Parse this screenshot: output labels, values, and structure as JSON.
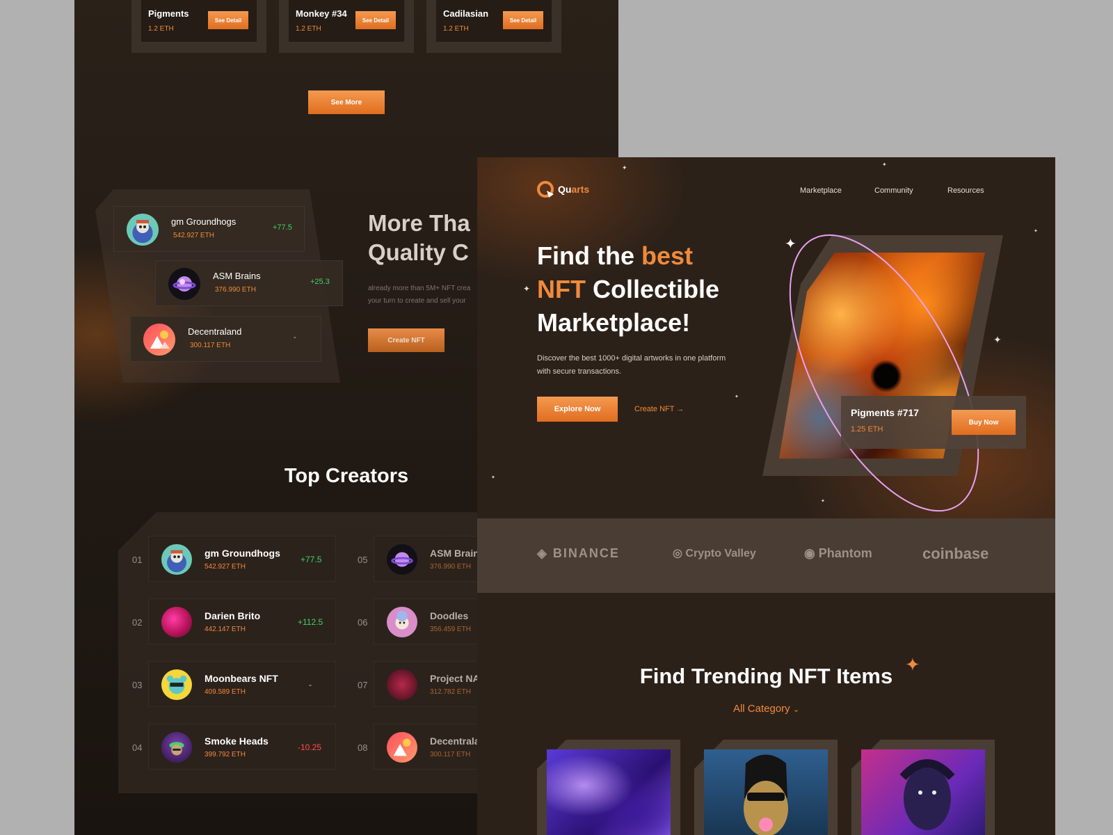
{
  "back": {
    "nft_cards": [
      {
        "name": "Pigments",
        "price": "1.2 ETH",
        "button": "See Detail"
      },
      {
        "name": "Monkey #34",
        "price": "1.2 ETH",
        "button": "See Detail"
      },
      {
        "name": "Cadilasian",
        "price": "1.2 ETH",
        "button": "See Detail"
      }
    ],
    "see_more": "See More",
    "stack": [
      {
        "name": "gm Groundhogs",
        "eth": "542.927 ETH",
        "delta": "+77.5"
      },
      {
        "name": "ASM Brains",
        "eth": "376.990 ETH",
        "delta": "+25.3"
      },
      {
        "name": "Decentraland",
        "eth": "300.117 ETH",
        "delta": "-"
      }
    ],
    "more_title_line1": "More Tha",
    "more_title_line2": "Quality C",
    "more_desc_line1": "already more than 5M+ NFT crea",
    "more_desc_line2": "your turn to create and sell your",
    "create_nft": "Create NFT",
    "top_creators_title": "Top Creators",
    "creators_left": [
      {
        "num": "01",
        "name": "gm Groundhogs",
        "eth": "542.927 ETH",
        "delta": "+77.5",
        "trend": "up"
      },
      {
        "num": "02",
        "name": "Darien Brito",
        "eth": "442.147 ETH",
        "delta": "+112.5",
        "trend": "up"
      },
      {
        "num": "03",
        "name": "Moonbears NFT",
        "eth": "409.589 ETH",
        "delta": "-",
        "trend": "flat"
      },
      {
        "num": "04",
        "name": "Smoke Heads",
        "eth": "399.792 ETH",
        "delta": "-10.25",
        "trend": "down"
      }
    ],
    "creators_right": [
      {
        "num": "05",
        "name": "ASM Brain",
        "eth": "376.990 ETH"
      },
      {
        "num": "06",
        "name": "Doodles",
        "eth": "356.459 ETH"
      },
      {
        "num": "07",
        "name": "Project NA",
        "eth": "312.782 ETH"
      },
      {
        "num": "08",
        "name": "Decentrala",
        "eth": "300.117 ETH"
      }
    ]
  },
  "front": {
    "logo_a": "Qu",
    "logo_b": "arts",
    "nav": [
      "Marketplace",
      "Community",
      "Resources"
    ],
    "hero": {
      "l1a": "Find the ",
      "l1b": "best",
      "l2a": "NFT",
      "l2b": " Collectible",
      "l3": "Marketplace!",
      "desc": "Discover the best 1000+ digital artworks in one platform with secure transactions.",
      "explore": "Explore Now",
      "create": "Create NFT"
    },
    "featured": {
      "name": "Pigments #717",
      "eth": "1.25 ETH",
      "button": "Buy Now"
    },
    "brands": [
      "BINANCE",
      "Crypto Valley",
      "Phantom",
      "coinbase"
    ],
    "trending_title": "Find Trending NFT Items",
    "category": "All Category"
  },
  "colors": {
    "accent": "#f08a3c",
    "bg_dark": "#2c2119",
    "up": "#3dd36a",
    "down": "#ff4d4d"
  }
}
